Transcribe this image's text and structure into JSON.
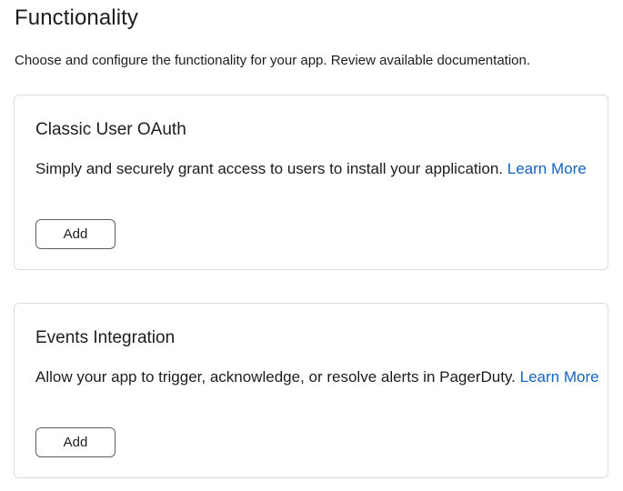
{
  "page": {
    "title": "Functionality",
    "description": "Choose and configure the functionality for your app. Review available documentation."
  },
  "cards": [
    {
      "title": "Classic User OAuth",
      "description": "Simply and securely grant access to users to install your application.",
      "link_label": "Learn More",
      "button_label": "Add"
    },
    {
      "title": "Events Integration",
      "description": "Allow your app to trigger, acknowledge, or resolve alerts in PagerDuty.",
      "link_label": "Learn More",
      "button_label": "Add"
    }
  ],
  "colors": {
    "link": "#1565c0",
    "border": "#dcdcdc"
  }
}
